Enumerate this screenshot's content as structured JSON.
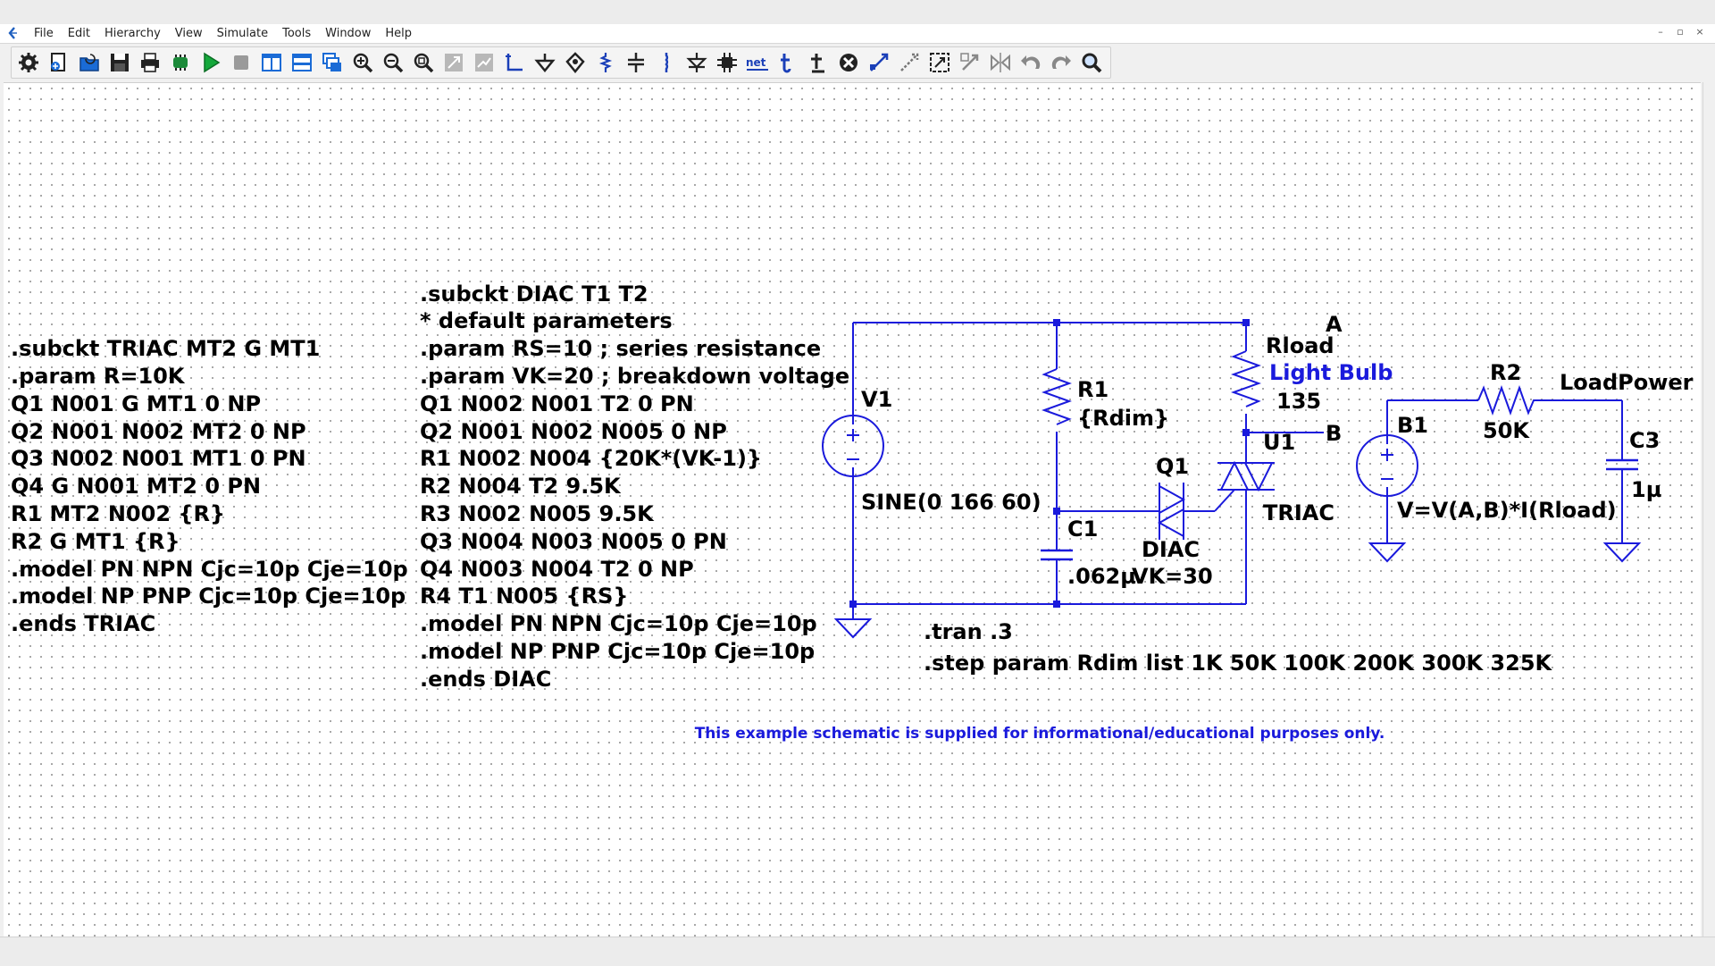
{
  "menu": {
    "items": [
      "File",
      "Edit",
      "Hierarchy",
      "View",
      "Simulate",
      "Tools",
      "Window",
      "Help"
    ]
  },
  "window_controls": [
    "–",
    "▫",
    "×"
  ],
  "toolbar": {
    "buttons": [
      "settings",
      "new-schematic",
      "open",
      "save",
      "print",
      "control-panel",
      "run",
      "halt",
      "tile-vertical",
      "tile-horizontal",
      "cascade",
      "zoom-in",
      "zoom-out",
      "zoom-fit",
      "pan",
      "autoscale",
      "draw-wire",
      "ground",
      "label-net",
      "resistor",
      "capacitor",
      "inductor",
      "diode",
      "component",
      "net-label",
      "text",
      "spice-directive",
      "delete",
      "duplicate",
      "move",
      "drag",
      "rotate",
      "mirror",
      "undo",
      "redo",
      "find"
    ],
    "net_label": "net"
  },
  "schematic": {
    "triac_netlist": [
      ".subckt TRIAC MT2 G MT1",
      ".param R=10K",
      "Q1 N001 G MT1 0 NP",
      "Q2 N001 N002 MT2 0 NP",
      "Q3 N002 N001 MT1 0 PN",
      "Q4 G N001 MT2 0 PN",
      "R1 MT2 N002 {R}",
      "R2 G MT1 {R}",
      ".model PN NPN Cjc=10p Cje=10p",
      ".model NP PNP Cjc=10p Cje=10p",
      ".ends TRIAC"
    ],
    "diac_netlist": [
      ".subckt DIAC T1 T2",
      "* default parameters",
      ".param RS=10 ; series resistance",
      ".param VK=20 ; breakdown voltage",
      "Q1 N002 N001 T2 0 PN",
      "Q2 N001 N002 N005 0 NP",
      "R1 N002 N004 {20K*(VK-1)}",
      "R2 N004 T2 9.5K",
      "R3 N002 N005 9.5K",
      "Q3 N004 N003 N005 0 PN",
      "Q4 N003 N004 T2 0 NP",
      "R4 T1 N005 {RS}",
      ".model PN NPN Cjc=10p Cje=10p",
      ".model NP PNP Cjc=10p Cje=10p",
      ".ends DIAC"
    ],
    "labels": {
      "v1_name": "V1",
      "v1_value": "SINE(0 166 60)",
      "r1_name": "R1",
      "r1_value": "{Rdim}",
      "c1_name": "C1",
      "c1_value": ".062µ",
      "q1_name": "Q1",
      "q1_model": "DIAC",
      "vk_param": "VK=30",
      "rload_name": "Rload",
      "rload_desc": "Light Bulb",
      "rload_value": "135",
      "u1_name": "U1",
      "u1_model": "TRIAC",
      "node_a": "A",
      "node_b": "B",
      "b1_name": "B1",
      "b1_value": "V=V(A,B)*I(Rload)",
      "r2_name": "R2",
      "r2_value": "50K",
      "c3_name": "C3",
      "c3_value": "1µ",
      "loadpower_net": "LoadPower"
    },
    "directives": {
      "tran": ".tran .3",
      "step": ".step param Rdim list 1K 50K 100K 200K 300K 325K"
    },
    "disclaimer": "This example schematic is supplied for informational/educational purposes only.",
    "colors": {
      "wire": "#1a1adc",
      "component": "#1a1adc",
      "text": "#000000",
      "accent_text": "#1a1adc",
      "junction": "#1a1adc"
    }
  }
}
